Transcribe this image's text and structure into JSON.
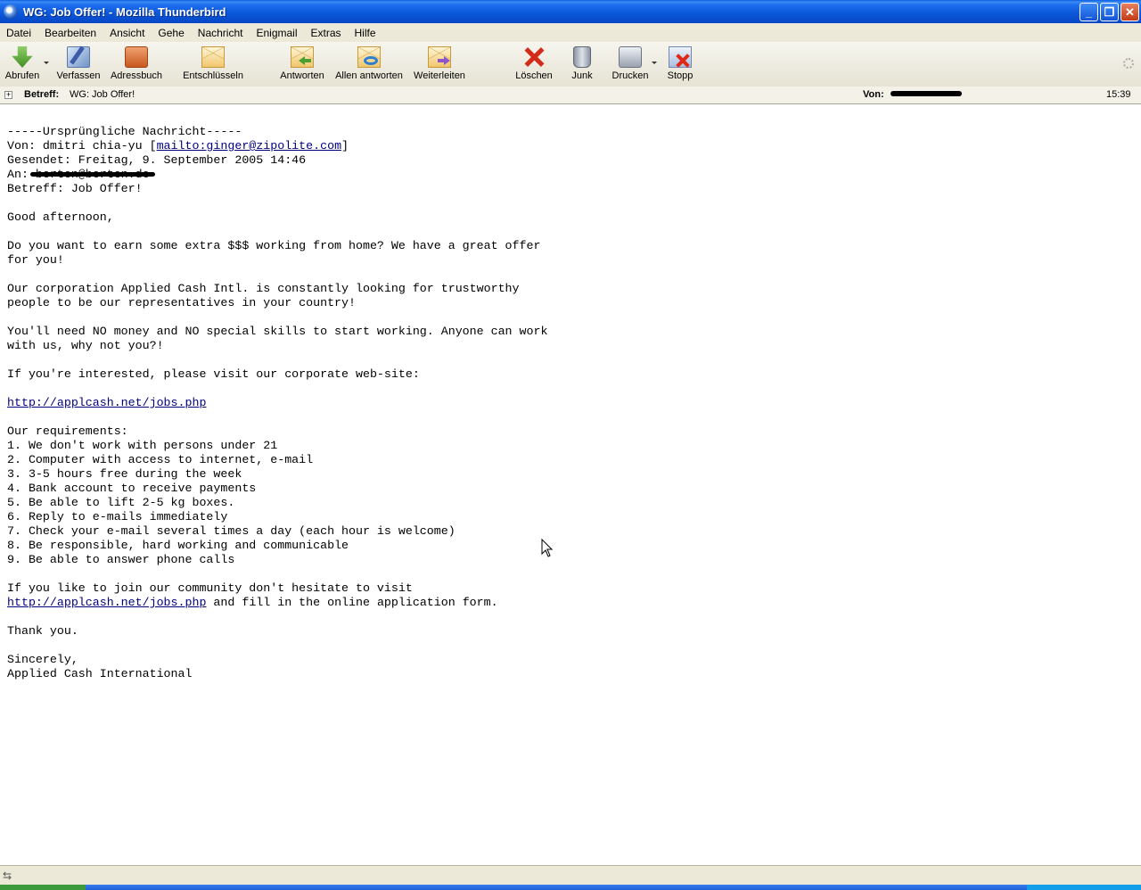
{
  "window": {
    "title": "WG: Job Offer! - Mozilla Thunderbird",
    "buttons": [
      "_",
      "❐",
      "✕"
    ]
  },
  "menu": [
    "Datei",
    "Bearbeiten",
    "Ansicht",
    "Gehe",
    "Nachricht",
    "Enigmail",
    "Extras",
    "Hilfe"
  ],
  "toolbar": {
    "get": "Abrufen",
    "write": "Verfassen",
    "address_book": "Adressbuch",
    "decrypt": "Entschlüsseln",
    "reply": "Antworten",
    "reply_all": "Allen antworten",
    "forward": "Weiterleiten",
    "delete": "Löschen",
    "junk": "Junk",
    "print": "Drucken",
    "stop": "Stopp"
  },
  "header": {
    "subject_label": "Betreff:",
    "subject_value": "WG: Job Offer!",
    "from_label": "Von:",
    "time": "15:39"
  },
  "message": {
    "lines": [
      "-----Ursprüngliche Nachricht-----",
      {
        "pre": "Von: dmitri chia-yu [",
        "link": "mailto:ginger@zipolite.com",
        "post": "]"
      },
      "Gesendet: Freitag, 9. September 2005 14:46",
      {
        "pre": "An: ",
        "redacted": "berten@berten.de"
      },
      "Betreff: Job Offer!",
      "",
      "Good afternoon,",
      "",
      "Do you want to earn some extra $$$ working from home? We have a great offer",
      "for you!",
      "",
      "Our corporation Applied Cash Intl. is constantly looking for trustworthy",
      "people to be our representatives in your country!",
      "",
      "You'll need NO money and NO special skills to start working. Anyone can work",
      "with us, why not you?!",
      "",
      "If you're interested, please visit our corporate web-site:",
      "",
      {
        "pre": "",
        "link": "http://applcash.net/jobs.php",
        "post": ""
      },
      "",
      "Our requirements:",
      "1. We don't work with persons under 21",
      "2. Computer with access to internet, e-mail",
      "3. 3-5 hours free during the week",
      "4. Bank account to receive payments",
      "5. Be able to lift 2-5 kg boxes.",
      "6. Reply to e-mails immediately",
      "7. Check your e-mail several times a day (each hour is welcome)",
      "8. Be responsible, hard working and communicable",
      "9. Be able to answer phone calls",
      "",
      "If you like to join our community don't hesitate to visit",
      {
        "pre": "",
        "link": "http://applcash.net/jobs.php",
        "post": " and fill in the online application form."
      },
      "",
      "Thank you.",
      "",
      "Sincerely,",
      "Applied Cash International"
    ]
  }
}
